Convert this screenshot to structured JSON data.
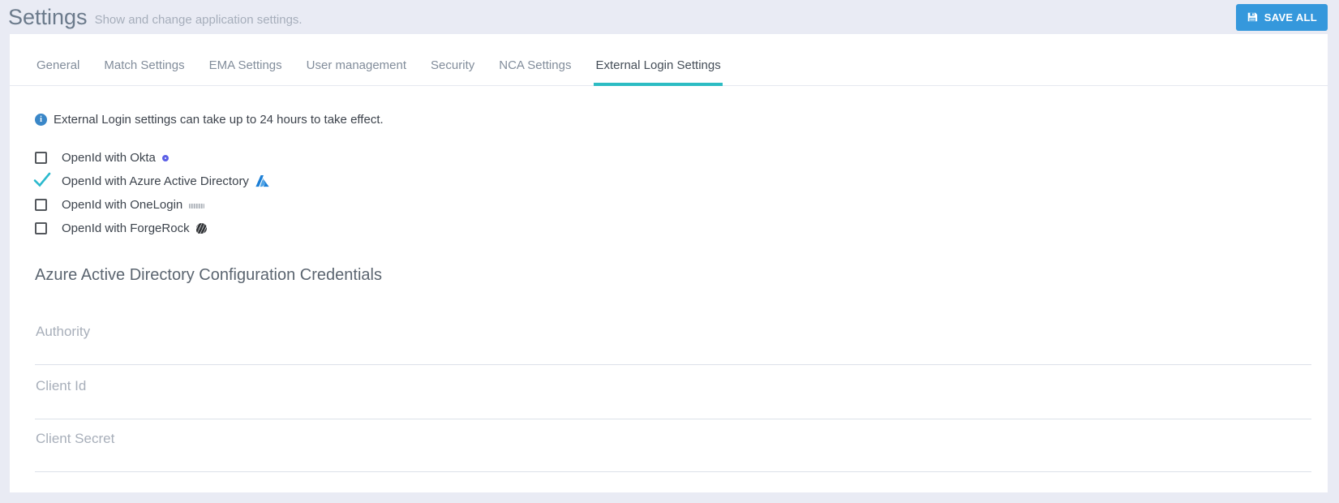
{
  "header": {
    "title": "Settings",
    "subtitle": "Show and change application settings.",
    "save_button_label": "SAVE ALL"
  },
  "tabs": [
    {
      "label": "General",
      "active": false
    },
    {
      "label": "Match Settings",
      "active": false
    },
    {
      "label": "EMA Settings",
      "active": false
    },
    {
      "label": "User management",
      "active": false
    },
    {
      "label": "Security",
      "active": false
    },
    {
      "label": "NCA Settings",
      "active": false
    },
    {
      "label": "External Login Settings",
      "active": true
    }
  ],
  "info_banner": {
    "icon": "info-icon",
    "icon_glyph": "i",
    "text": "External Login settings can take up to 24 hours to take effect."
  },
  "login_providers": [
    {
      "label": "OpenId with Okta",
      "checked": false,
      "icon": "okta-icon"
    },
    {
      "label": "OpenId with Azure Active Directory",
      "checked": true,
      "icon": "azure-icon"
    },
    {
      "label": "OpenId with OneLogin",
      "checked": false,
      "icon": "onelogin-icon"
    },
    {
      "label": "OpenId with ForgeRock",
      "checked": false,
      "icon": "forgerock-icon"
    }
  ],
  "credentials_section": {
    "heading": "Azure Active Directory Configuration Credentials",
    "fields": [
      {
        "label": "Authority",
        "value": ""
      },
      {
        "label": "Client Id",
        "value": ""
      },
      {
        "label": "Client Secret",
        "value": ""
      }
    ]
  },
  "colors": {
    "page_background": "#e9ebf4",
    "card_background": "#ffffff",
    "accent_teal": "#2dbcc3",
    "button_blue": "#3598dc",
    "check_cyan": "#2ab9cd",
    "info_blue": "#3a87c8",
    "okta_indigo": "#5b5fe6",
    "azure_blue": "#1c7fd6"
  }
}
